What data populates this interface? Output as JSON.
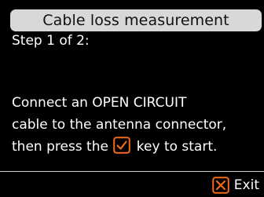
{
  "header": {
    "title": "Cable loss measurement"
  },
  "step": {
    "text": "Step 1 of 2:"
  },
  "instructions": {
    "line1": "Connect an OPEN CIRCUIT",
    "line2": "cable to the antenna connector,",
    "line3_before": "then press the",
    "line3_after": "key to start.",
    "key_icon": "check-box-icon"
  },
  "footer": {
    "exit_label": "Exit",
    "exit_icon": "x-box-icon"
  },
  "colors": {
    "background": "#000000",
    "text": "#ffffff",
    "title_bar": "#d8d8d8",
    "title_text": "#111111",
    "accent": "#f26a1b"
  }
}
